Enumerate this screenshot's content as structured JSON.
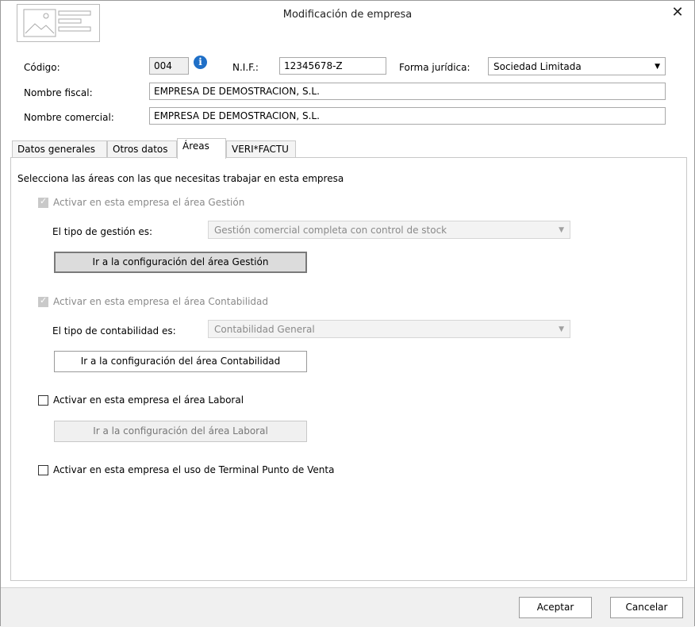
{
  "window": {
    "title": "Modificación de empresa",
    "close_symbol": "✕"
  },
  "header": {
    "codigo_label": "Código:",
    "codigo_value": "004",
    "nif_label": "N.I.F.:",
    "nif_value": "12345678-Z",
    "forma_label": "Forma jurídica:",
    "forma_value": "Sociedad Limitada",
    "nombre_fiscal_label": "Nombre fiscal:",
    "nombre_fiscal_value": "EMPRESA DE DEMOSTRACION, S.L.",
    "nombre_comercial_label": "Nombre comercial:",
    "nombre_comercial_value": "EMPRESA DE DEMOSTRACION, S.L."
  },
  "tabs": [
    {
      "label": "Datos generales"
    },
    {
      "label": "Otros datos"
    },
    {
      "label": "Áreas"
    },
    {
      "label": "VERI*FACTU"
    }
  ],
  "areas": {
    "intro": "Selecciona las áreas con las que necesitas trabajar en esta empresa",
    "gestion": {
      "check_label": "Activar en esta empresa el área Gestión",
      "checked": true,
      "enabled": false,
      "tipo_label": "El tipo de gestión es:",
      "tipo_value": "Gestión comercial completa con control de stock",
      "button": "Ir a la configuración del área Gestión"
    },
    "contabilidad": {
      "check_label": "Activar en esta empresa el área Contabilidad",
      "checked": true,
      "enabled": false,
      "tipo_label": "El tipo de contabilidad es:",
      "tipo_value": "Contabilidad General",
      "button": "Ir a la configuración del área Contabilidad"
    },
    "laboral": {
      "check_label": "Activar en esta empresa el área Laboral",
      "checked": false,
      "enabled": true,
      "button": "Ir a la configuración del área Laboral"
    },
    "tpv": {
      "check_label": "Activar en esta empresa el uso de Terminal Punto de Venta",
      "checked": false,
      "enabled": true
    }
  },
  "footer": {
    "accept": "Aceptar",
    "cancel": "Cancelar"
  },
  "colors": {
    "info_icon": "#1f6fc7",
    "disabled_text": "#8a8a8a",
    "footer_bg": "#f0f0f0"
  }
}
